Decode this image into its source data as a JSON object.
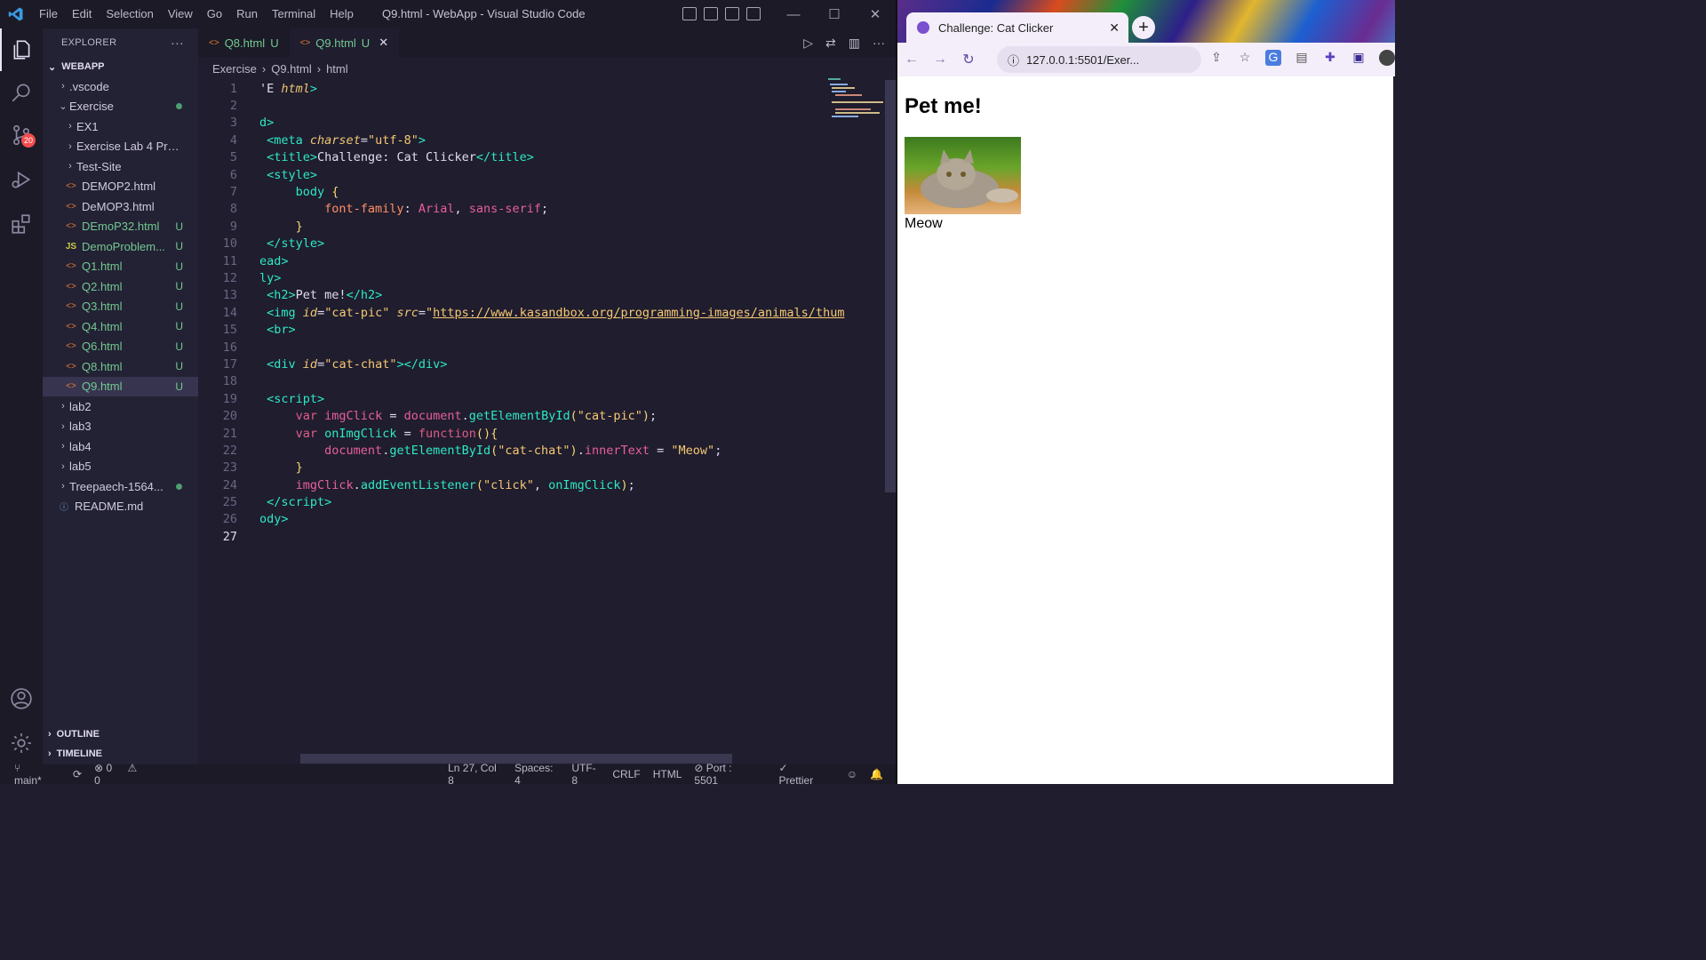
{
  "vscode": {
    "menu": [
      "File",
      "Edit",
      "Selection",
      "View",
      "Go",
      "Run",
      "Terminal",
      "Help"
    ],
    "window_title": "Q9.html - WebApp - Visual Studio Code",
    "activity": {
      "scm_badge": "20"
    },
    "explorer": {
      "header": "EXPLORER",
      "more": "···",
      "root": "WEBAPP",
      "items": [
        {
          "label": ".vscode",
          "type": "folder",
          "level": 1,
          "expanded": false
        },
        {
          "label": "Exercise",
          "type": "folder",
          "level": 1,
          "expanded": true,
          "dot": true
        },
        {
          "label": "EX1",
          "type": "folder",
          "level": 2,
          "expanded": false
        },
        {
          "label": "Exercise Lab 4 Probl...",
          "type": "folder",
          "level": 2,
          "expanded": false
        },
        {
          "label": "Test-Site",
          "type": "folder",
          "level": 2,
          "expanded": false
        },
        {
          "label": "DEMOP2.html",
          "type": "html",
          "level": 2
        },
        {
          "label": "DeMOP3.html",
          "type": "html",
          "level": 2
        },
        {
          "label": "DEmoP32.html",
          "type": "html",
          "level": 2,
          "status": "U"
        },
        {
          "label": "DemoProblem...",
          "type": "js",
          "level": 2,
          "status": "U"
        },
        {
          "label": "Q1.html",
          "type": "html",
          "level": 2,
          "status": "U"
        },
        {
          "label": "Q2.html",
          "type": "html",
          "level": 2,
          "status": "U"
        },
        {
          "label": "Q3.html",
          "type": "html",
          "level": 2,
          "status": "U"
        },
        {
          "label": "Q4.html",
          "type": "html",
          "level": 2,
          "status": "U"
        },
        {
          "label": "Q6.html",
          "type": "html",
          "level": 2,
          "status": "U"
        },
        {
          "label": "Q8.html",
          "type": "html",
          "level": 2,
          "status": "U"
        },
        {
          "label": "Q9.html",
          "type": "html",
          "level": 2,
          "status": "U",
          "selected": true
        },
        {
          "label": "lab2",
          "type": "folder",
          "level": 1,
          "expanded": false
        },
        {
          "label": "lab3",
          "type": "folder",
          "level": 1,
          "expanded": false
        },
        {
          "label": "lab4",
          "type": "folder",
          "level": 1,
          "expanded": false
        },
        {
          "label": "lab5",
          "type": "folder",
          "level": 1,
          "expanded": false
        },
        {
          "label": "Treepaech-1564...",
          "type": "folder",
          "level": 1,
          "expanded": false,
          "dot": true
        },
        {
          "label": "README.md",
          "type": "info",
          "level": 1
        }
      ],
      "outline": "OUTLINE",
      "timeline": "TIMELINE"
    },
    "tabs": [
      {
        "label": "Q8.html",
        "status": "U",
        "active": false
      },
      {
        "label": "Q9.html",
        "status": "U",
        "active": true
      }
    ],
    "breadcrumb": [
      "Exercise",
      "Q9.html",
      "html"
    ],
    "code_lines": [
      "<span class='p'>'E </span><span class='a'>html</span><span class='t'>&gt;</span>",
      "",
      "<span class='t'>d&gt;</span>",
      " <span class='t'>&lt;meta</span> <span class='a'>charset</span><span class='p'>=</span><span class='s'>\"utf-8\"</span><span class='t'>&gt;</span>",
      " <span class='t'>&lt;title&gt;</span><span class='p'>Challenge: Cat Clicker</span><span class='t'>&lt;/title&gt;</span>",
      " <span class='t'>&lt;style&gt;</span>",
      "     <span class='t'>body</span> <span class='f'>{</span>",
      "         <span class='prop'>font-family</span><span class='p'>: </span><span class='v'>Arial</span><span class='p'>, </span><span class='v'>sans-serif</span><span class='p'>;</span>",
      "     <span class='f'>}</span>",
      " <span class='t'>&lt;/style&gt;</span>",
      "<span class='t'>ead&gt;</span>",
      "<span class='t'>ly&gt;</span>",
      " <span class='t'>&lt;h2&gt;</span><span class='p'>Pet me!</span><span class='t'>&lt;/h2&gt;</span>",
      " <span class='t'>&lt;img</span> <span class='a'>id</span><span class='p'>=</span><span class='s'>\"cat-pic\"</span> <span class='a'>src</span><span class='p'>=</span><span class='s'>\"</span><span class='url'>https://www.kasandbox.org/programming-images/animals/thum</span>",
      " <span class='t'>&lt;br&gt;</span>",
      "",
      " <span class='t'>&lt;div</span> <span class='a'>id</span><span class='p'>=</span><span class='s'>\"cat-chat\"</span><span class='t'>&gt;&lt;/div&gt;</span>",
      "",
      " <span class='t'>&lt;script&gt;</span>",
      "     <span class='k'>var</span> <span class='v'>imgClick</span> <span class='p'>=</span> <span class='v'>document</span><span class='p'>.</span><span class='t'>getElementById</span><span class='f'>(</span><span class='s'>\"cat-pic\"</span><span class='f'>)</span><span class='p'>;</span>",
      "     <span class='k'>var</span> <span class='t'>onImgClick</span> <span class='p'>=</span> <span class='k'>function</span><span class='f'>(){</span>",
      "         <span class='v'>document</span><span class='p'>.</span><span class='t'>getElementById</span><span class='f'>(</span><span class='s'>\"cat-chat\"</span><span class='f'>)</span><span class='p'>.</span><span class='v'>innerText</span> <span class='p'>=</span> <span class='s'>\"Meow\"</span><span class='p'>;</span>",
      "     <span class='f'>}</span>",
      "     <span class='v'>imgClick</span><span class='p'>.</span><span class='t'>addEventListener</span><span class='f'>(</span><span class='s'>\"click\"</span><span class='p'>, </span><span class='t'>onImgClick</span><span class='f'>)</span><span class='p'>;</span>",
      " <span class='t'>&lt;/script&gt;</span>",
      "<span class='t'>ody&gt;</span>",
      ""
    ],
    "current_line": 27,
    "status": {
      "branch": "main*",
      "errors": "0",
      "warnings": "0",
      "position": "Ln 27, Col 8",
      "spaces": "Spaces: 4",
      "encoding": "UTF-8",
      "eol": "CRLF",
      "language": "HTML",
      "port": "Port : 5501",
      "formatter": "Prettier"
    }
  },
  "browser": {
    "tab_title": "Challenge: Cat Clicker",
    "url": "127.0.0.1:5501/Exer...",
    "page": {
      "heading": "Pet me!",
      "cat_chat": "Meow"
    }
  }
}
